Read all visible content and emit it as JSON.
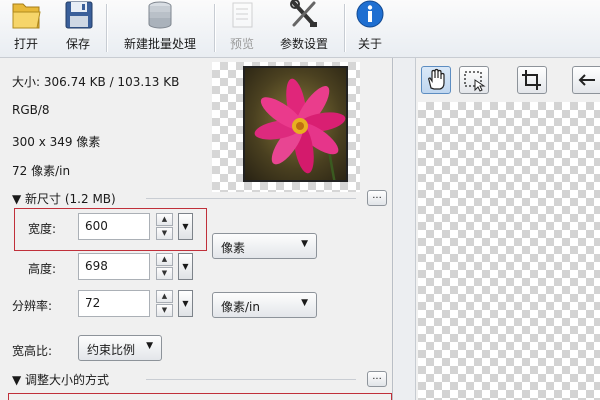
{
  "toolbar": {
    "open_label": "打开",
    "save_label": "保存",
    "batch_label": "新建批量处理",
    "preview_label": "预览",
    "settings_label": "参数设置",
    "about_label": "关于"
  },
  "info": {
    "size": "大小: 306.74 KB / 103.13 KB",
    "mode": "RGB/8",
    "dimensions": "300 x 349 像素",
    "resolution": "72 像素/in"
  },
  "new_size": {
    "heading": "▼ 新尺寸 (1.2 MB)",
    "more_button": "...",
    "width_label": "宽度:",
    "width_value": "600",
    "height_label": "高度:",
    "height_value": "698",
    "unit_select": "像素",
    "dpi_label": "分辨率:",
    "dpi_value": "72",
    "dpi_unit_select": "像素/in",
    "aspect_label": "宽高比:",
    "aspect_select": "约束比例"
  },
  "resize_method": {
    "heading": "▼ 调整大小的方式",
    "more_button": "..."
  },
  "colors": {
    "highlight": "#c0303a",
    "info_icon": "#1f6fd1"
  },
  "icons": [
    "folder-icon",
    "floppy-disk-icon",
    "database-icon",
    "preview-icon",
    "tools-icon",
    "info-icon",
    "hand-icon",
    "marquee-select-icon",
    "crop-icon",
    "arrow-left-icon"
  ]
}
